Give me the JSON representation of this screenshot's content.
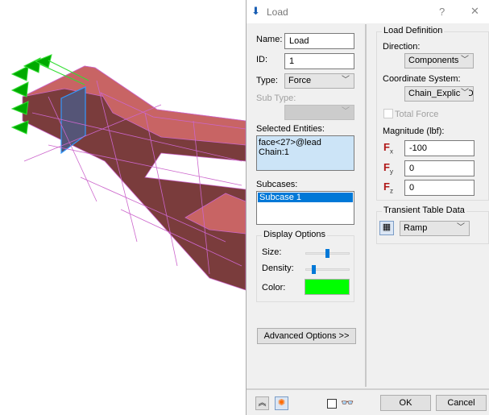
{
  "dialog": {
    "title": "Load",
    "help": "?",
    "close": "✕"
  },
  "left": {
    "name_label": "Name:",
    "name_value": "Load",
    "id_label": "ID:",
    "id_value": "1",
    "type_label": "Type:",
    "type_value": "Force",
    "subtype_label": "Sub Type:",
    "subtype_value": "",
    "selected_label": "Selected Entities:",
    "selected_items": [
      "face<27>@lead Chain:1"
    ],
    "subcases_label": "Subcases:",
    "subcases": [
      "Subcase 1"
    ],
    "display": {
      "title": "Display Options",
      "size_label": "Size:",
      "size_value": 0.5,
      "density_label": "Density:",
      "density_value": 0.15,
      "color_label": "Color:",
      "color": "#00ff00"
    },
    "advanced_label": "Advanced Options >>"
  },
  "right": {
    "load_def_title": "Load Definition",
    "direction_label": "Direction:",
    "direction_value": "Components",
    "coord_label": "Coordinate System:",
    "coord_value": "Chain_Explicit D",
    "total_force_label": "Total Force",
    "total_force_checked": false,
    "magnitude_label": "Magnitude (lbf):",
    "components": [
      {
        "sym": "F",
        "sub": "x",
        "value": "-100"
      },
      {
        "sym": "F",
        "sub": "y",
        "value": "0"
      },
      {
        "sym": "F",
        "sub": "z",
        "value": "0"
      }
    ],
    "transient_title": "Transient Table Data",
    "transient_value": "Ramp"
  },
  "footer": {
    "ok": "OK",
    "cancel": "Cancel",
    "preview_checked": false
  },
  "colors": {
    "mesh_face": "#7a3c3c",
    "mesh_top": "#c86464",
    "mesh_edge": "#cc66cc",
    "arrows": "#00aa00",
    "selection": "#3399ff"
  }
}
